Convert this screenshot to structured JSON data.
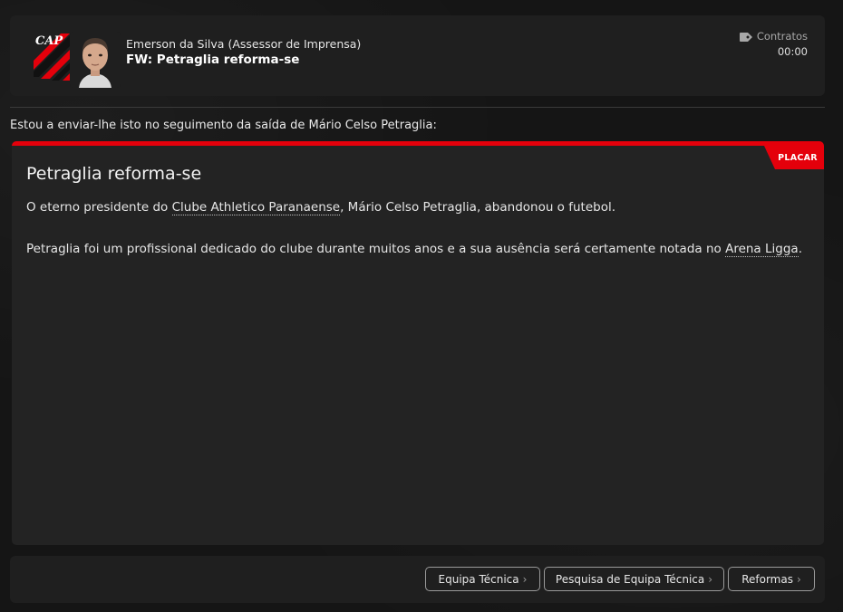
{
  "header": {
    "sender": "Emerson da Silva  (Assessor de Imprensa)",
    "subject": "FW: Petraglia reforma-se",
    "category": "Contratos",
    "category_icon": "tag-icon",
    "time": "00:00"
  },
  "intro": "Estou a enviar-lhe isto no seguimento da saída de Mário Celso Petraglia:",
  "article": {
    "source_badge": "PLACAR",
    "title": "Petraglia reforma-se",
    "para1_before": "O eterno presidente do ",
    "para1_link": "Clube Athletico Paranaense",
    "para1_after": ", Mário Celso Petraglia, abandonou o futebol.",
    "para2_before": "Petraglia foi um profissional dedicado do clube durante muitos anos e a sua ausência será certamente notada no ",
    "para2_link": "Arena Ligga",
    "para2_after": "."
  },
  "footer": {
    "buttons": [
      {
        "label": "Equipa Técnica"
      },
      {
        "label": "Pesquisa de Equipa Técnica"
      },
      {
        "label": "Reformas"
      }
    ]
  },
  "colors": {
    "accent": "#e4000b",
    "panel": "#232323",
    "background": "#151515"
  }
}
